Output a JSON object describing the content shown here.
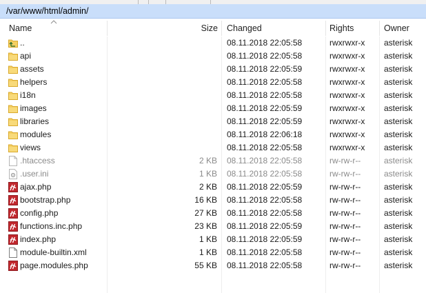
{
  "path": "/var/www/html/admin/",
  "columns": {
    "name": "Name",
    "size": "Size",
    "changed": "Changed",
    "rights": "Rights",
    "owner": "Owner"
  },
  "files": [
    {
      "name": "..",
      "size": "",
      "changed": "08.11.2018 22:05:58",
      "rights": "rwxrwxr-x",
      "owner": "asterisk",
      "icon": "folder-up-icon",
      "dim": false
    },
    {
      "name": "api",
      "size": "",
      "changed": "08.11.2018 22:05:58",
      "rights": "rwxrwxr-x",
      "owner": "asterisk",
      "icon": "folder-icon",
      "dim": false
    },
    {
      "name": "assets",
      "size": "",
      "changed": "08.11.2018 22:05:59",
      "rights": "rwxrwxr-x",
      "owner": "asterisk",
      "icon": "folder-icon",
      "dim": false
    },
    {
      "name": "helpers",
      "size": "",
      "changed": "08.11.2018 22:05:58",
      "rights": "rwxrwxr-x",
      "owner": "asterisk",
      "icon": "folder-icon",
      "dim": false
    },
    {
      "name": "i18n",
      "size": "",
      "changed": "08.11.2018 22:05:58",
      "rights": "rwxrwxr-x",
      "owner": "asterisk",
      "icon": "folder-icon",
      "dim": false
    },
    {
      "name": "images",
      "size": "",
      "changed": "08.11.2018 22:05:59",
      "rights": "rwxrwxr-x",
      "owner": "asterisk",
      "icon": "folder-icon",
      "dim": false
    },
    {
      "name": "libraries",
      "size": "",
      "changed": "08.11.2018 22:05:59",
      "rights": "rwxrwxr-x",
      "owner": "asterisk",
      "icon": "folder-icon",
      "dim": false
    },
    {
      "name": "modules",
      "size": "",
      "changed": "08.11.2018 22:06:18",
      "rights": "rwxrwxr-x",
      "owner": "asterisk",
      "icon": "folder-icon",
      "dim": false
    },
    {
      "name": "views",
      "size": "",
      "changed": "08.11.2018 22:05:58",
      "rights": "rwxrwxr-x",
      "owner": "asterisk",
      "icon": "folder-icon",
      "dim": false
    },
    {
      "name": ".htaccess",
      "size": "2 KB",
      "changed": "08.11.2018 22:05:58",
      "rights": "rw-rw-r--",
      "owner": "asterisk",
      "icon": "hidden-file-icon",
      "dim": true
    },
    {
      "name": ".user.ini",
      "size": "1 KB",
      "changed": "08.11.2018 22:05:58",
      "rights": "rw-rw-r--",
      "owner": "asterisk",
      "icon": "hidden-settings-file-icon",
      "dim": true
    },
    {
      "name": "ajax.php",
      "size": "2 KB",
      "changed": "08.11.2018 22:05:59",
      "rights": "rw-rw-r--",
      "owner": "asterisk",
      "icon": "php-file-icon",
      "dim": false
    },
    {
      "name": "bootstrap.php",
      "size": "16 KB",
      "changed": "08.11.2018 22:05:58",
      "rights": "rw-rw-r--",
      "owner": "asterisk",
      "icon": "php-file-icon",
      "dim": false
    },
    {
      "name": "config.php",
      "size": "27 KB",
      "changed": "08.11.2018 22:05:58",
      "rights": "rw-rw-r--",
      "owner": "asterisk",
      "icon": "php-file-icon",
      "dim": false
    },
    {
      "name": "functions.inc.php",
      "size": "23 KB",
      "changed": "08.11.2018 22:05:59",
      "rights": "rw-rw-r--",
      "owner": "asterisk",
      "icon": "php-file-icon",
      "dim": false
    },
    {
      "name": "index.php",
      "size": "1 KB",
      "changed": "08.11.2018 22:05:59",
      "rights": "rw-rw-r--",
      "owner": "asterisk",
      "icon": "php-file-icon",
      "dim": false
    },
    {
      "name": "module-builtin.xml",
      "size": "1 KB",
      "changed": "08.11.2018 22:05:58",
      "rights": "rw-rw-r--",
      "owner": "asterisk",
      "icon": "xml-file-icon",
      "dim": false
    },
    {
      "name": "page.modules.php",
      "size": "55 KB",
      "changed": "08.11.2018 22:05:58",
      "rights": "rw-rw-r--",
      "owner": "asterisk",
      "icon": "php-file-icon",
      "dim": false
    }
  ],
  "colors": {
    "path_bar": "#c9defa",
    "folder": "#f5cf62",
    "php_icon": "#c1272d",
    "dim_text": "#8a8a8a"
  }
}
